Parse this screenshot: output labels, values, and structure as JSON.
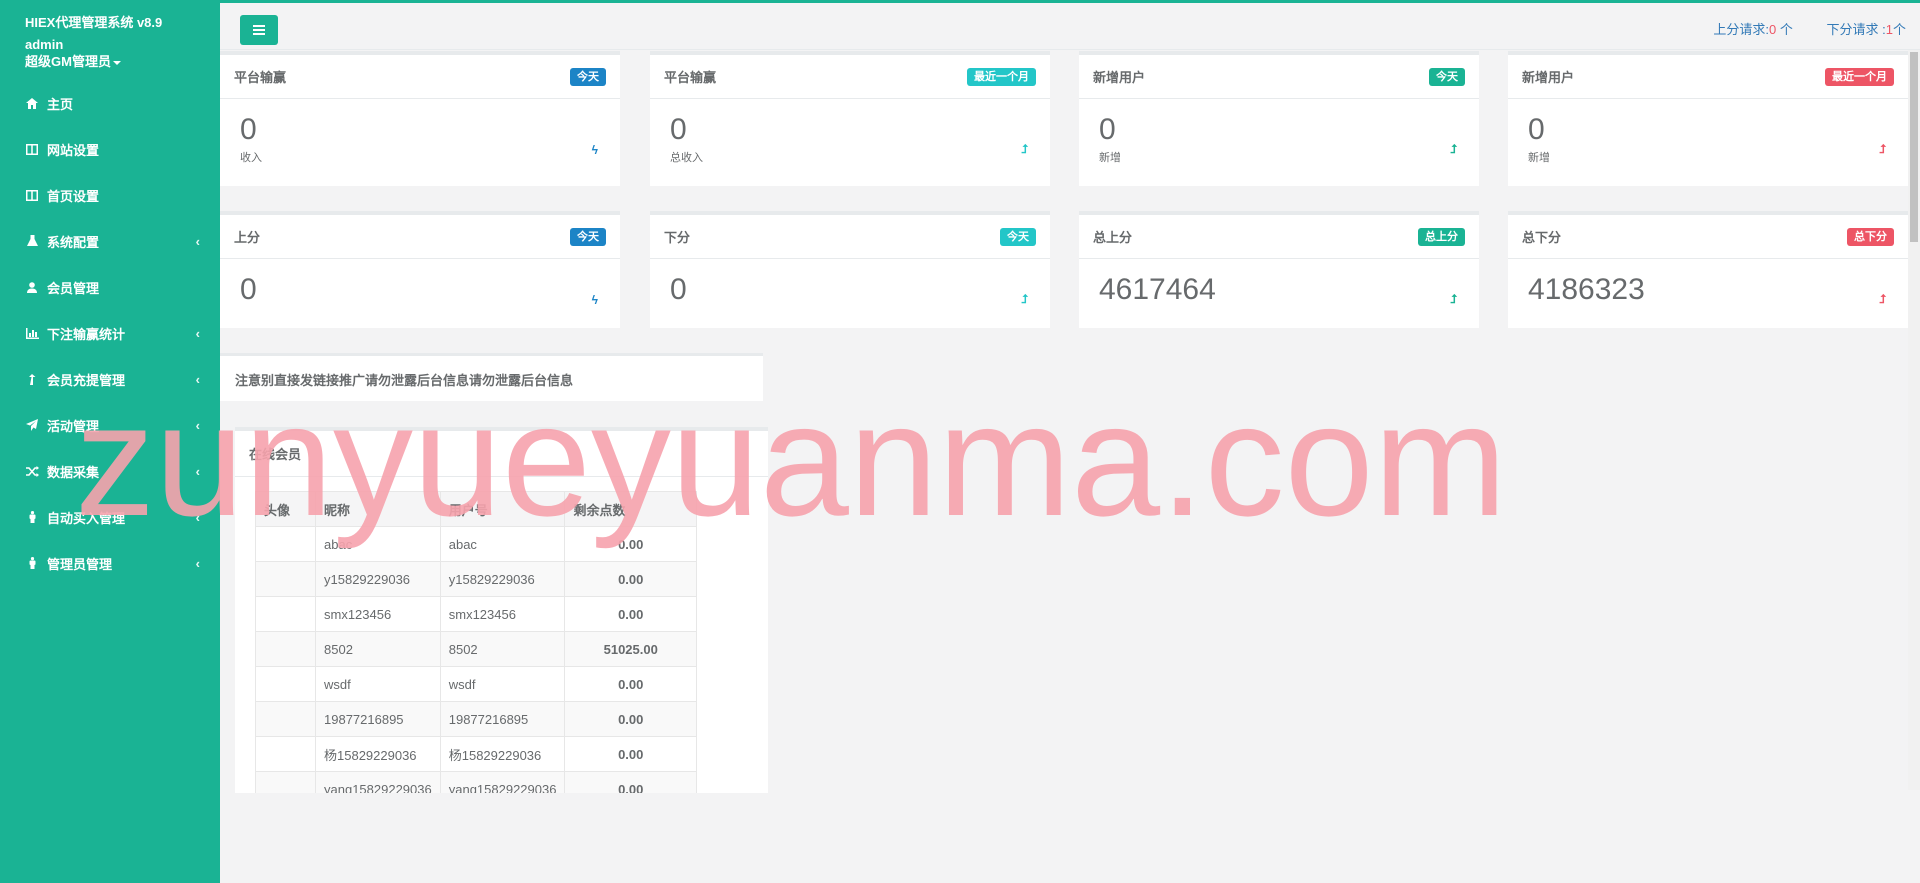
{
  "app": {
    "title": "HIEX代理管理系统 v8.9",
    "user": "admin",
    "role": "超级GM管理员"
  },
  "sidebar": {
    "items": [
      {
        "label": "主页",
        "icon": "home-icon",
        "arrow": ""
      },
      {
        "label": "网站设置",
        "icon": "columns-icon",
        "arrow": ""
      },
      {
        "label": "首页设置",
        "icon": "columns-icon",
        "arrow": ""
      },
      {
        "label": "系统配置",
        "icon": "flask-icon",
        "arrow": "‹"
      },
      {
        "label": "会员管理",
        "icon": "user-icon",
        "arrow": ""
      },
      {
        "label": "下注输赢统计",
        "icon": "bar-chart-icon",
        "arrow": "‹"
      },
      {
        "label": "会员充提管理",
        "icon": "level-up-icon",
        "arrow": "‹"
      },
      {
        "label": "活动管理",
        "icon": "paper-plane-icon",
        "arrow": "‹"
      },
      {
        "label": "数据采集",
        "icon": "random-icon",
        "arrow": "‹"
      },
      {
        "label": "自动买入管理",
        "icon": "male-icon",
        "arrow": "‹"
      },
      {
        "label": "管理员管理",
        "icon": "male-icon",
        "arrow": "‹"
      }
    ]
  },
  "topbar": {
    "up_request_label": "上分请求:",
    "up_request_count": "0",
    "up_request_unit": " 个",
    "down_request_label": "下分请求 :",
    "down_request_count": "1",
    "down_request_unit": "个"
  },
  "cards": [
    {
      "title": "平台输赢",
      "badge": "今天",
      "badge_color": "#1c84c6",
      "value": "0",
      "sub": "收入",
      "indicator": "bolt-icon"
    },
    {
      "title": "平台输赢",
      "badge": "最近一个月",
      "badge_color": "#23c6c8",
      "value": "0",
      "sub": "总收入",
      "indicator": "level-up-icon"
    },
    {
      "title": "新增用户",
      "badge": "今天",
      "badge_color": "#1ab394",
      "value": "0",
      "sub": "新增",
      "indicator": "level-up-icon"
    },
    {
      "title": "新增用户",
      "badge": "最近一个月",
      "badge_color": "#ed5565",
      "value": "0",
      "sub": "新增",
      "indicator": "level-up-icon"
    },
    {
      "title": "上分",
      "badge": "今天",
      "badge_color": "#1c84c6",
      "value": "0",
      "sub": "",
      "indicator": "bolt-icon"
    },
    {
      "title": "下分",
      "badge": "今天",
      "badge_color": "#23c6c8",
      "value": "0",
      "sub": "",
      "indicator": "level-up-icon"
    },
    {
      "title": "总上分",
      "badge": "总上分",
      "badge_color": "#1ab394",
      "value": "4617464",
      "sub": "",
      "indicator": "level-up-icon"
    },
    {
      "title": "总下分",
      "badge": "总下分",
      "badge_color": "#ed5565",
      "value": "4186323",
      "sub": "",
      "indicator": "level-up-icon"
    }
  ],
  "notice": "注意别直接发链接推广请勿泄露后台信息请勿泄露后台信息",
  "online": {
    "title": "在线会员",
    "columns": [
      "头像",
      "昵称",
      "用户号",
      "剩余点数"
    ],
    "rows": [
      {
        "avatar": "",
        "nickname": "abac",
        "userid": "abac",
        "points": "0.00"
      },
      {
        "avatar": "",
        "nickname": "y15829229036",
        "userid": "y15829229036",
        "points": "0.00"
      },
      {
        "avatar": "",
        "nickname": "smx123456",
        "userid": "smx123456",
        "points": "0.00"
      },
      {
        "avatar": "",
        "nickname": "8502",
        "userid": "8502",
        "points": "51025.00"
      },
      {
        "avatar": "",
        "nickname": "wsdf",
        "userid": "wsdf",
        "points": "0.00"
      },
      {
        "avatar": "",
        "nickname": "19877216895",
        "userid": "19877216895",
        "points": "0.00"
      },
      {
        "avatar": "",
        "nickname": "杨15829229036",
        "userid": "杨15829229036",
        "points": "0.00"
      },
      {
        "avatar": "",
        "nickname": "yang15829229036",
        "userid": "yang15829229036",
        "points": "0.00"
      }
    ]
  },
  "watermark": "zunyueyuanma.com"
}
